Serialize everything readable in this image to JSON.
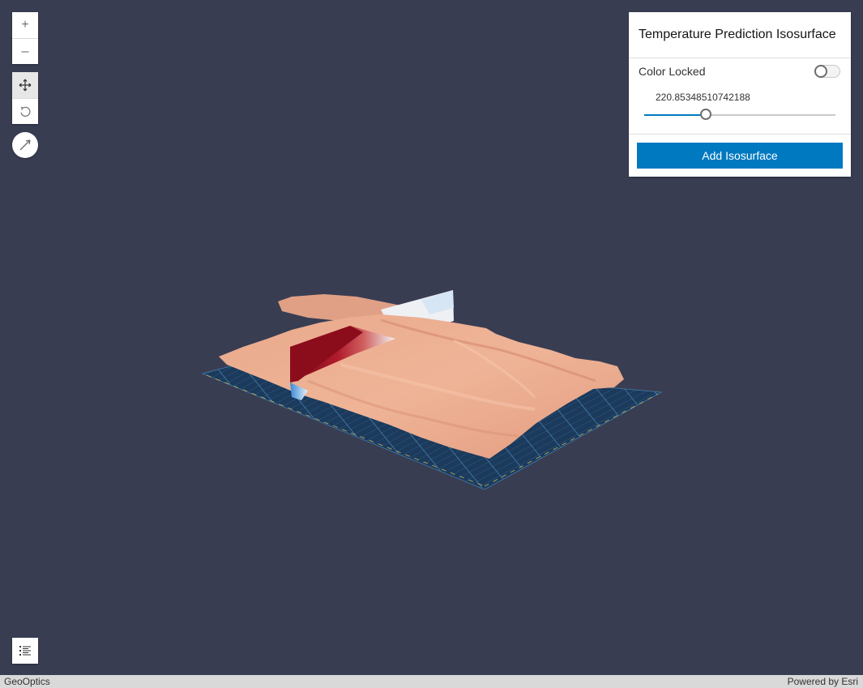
{
  "app": {
    "widgets": {
      "zoom_in_icon": "plus-icon",
      "zoom_out_icon": "minus-icon",
      "pan_icon": "pan-icon",
      "rotate_icon": "rotate-icon",
      "compass_icon": "compass-icon",
      "legend_icon": "legend-list-icon",
      "zoom_in_glyph": "+",
      "zoom_out_glyph": "–"
    },
    "panel": {
      "title": "Temperature Prediction Isosurface",
      "color_locked_label": "Color Locked",
      "color_locked": false,
      "slider_value": "220.85348510742188",
      "slider_fraction": 0.32,
      "add_button_label": "Add Isosurface"
    },
    "attribution": {
      "left": "GeoOptics",
      "right": "Powered by Esri"
    },
    "colors": {
      "background": "#393d52",
      "accent": "#0079c1",
      "isosurface": "#e8a487",
      "section_hot": "#8c0f1e",
      "grid": "#1b3555"
    }
  }
}
